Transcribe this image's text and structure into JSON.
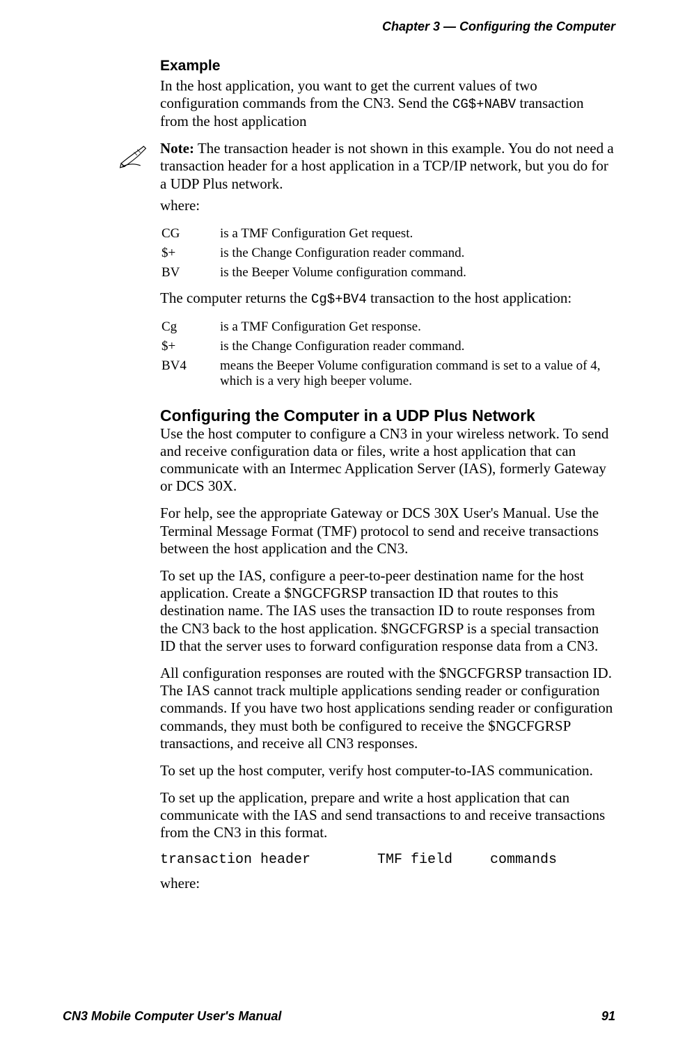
{
  "header": {
    "chapter_label": "Chapter 3 —  Configuring the Computer"
  },
  "example": {
    "heading": "Example",
    "intro_before_code": "In the host application, you want to get the current values of two configuration commands from the CN3. Send the ",
    "intro_code": "CG$+NABV",
    "intro_after_code": " transaction from the host application",
    "note_label": "Note:",
    "note_text": " The transaction header is not shown in this example. You do not need a transaction header for a host application in a TCP/IP network, but you do for a UDP Plus network.",
    "where_label": "where:",
    "table1": [
      {
        "term": "CG",
        "desc": "is a TMF Configuration Get request."
      },
      {
        "term": "$+",
        "desc": "is the Change Configuration reader command."
      },
      {
        "term": "BV",
        "desc": "is the Beeper Volume configuration command."
      }
    ],
    "returns_before_code": "The computer returns the ",
    "returns_code": "Cg$+BV4",
    "returns_after_code": " transaction to the host application:",
    "table2": [
      {
        "term": "Cg",
        "desc": "is a TMF Configuration Get response."
      },
      {
        "term": "$+",
        "desc": "is the Change Configuration reader command."
      },
      {
        "term": "BV4",
        "desc": "means the Beeper Volume configuration command is set to a value of 4, which is a very high beeper volume."
      }
    ]
  },
  "udp_section": {
    "heading": "Configuring the Computer in a UDP Plus Network",
    "p1": "Use the host computer to configure a CN3 in your wireless network. To send and receive configuration data or files, write a host application that can communicate with an Intermec Application Server (IAS), formerly Gateway or DCS 30X.",
    "p2": "For help, see the appropriate Gateway or DCS 30X User's Manual. Use the Terminal Message Format (TMF) protocol to send and receive transactions between the host application and the CN3.",
    "p3": "To set up the IAS, configure a peer-to-peer destination name for the host application. Create a $NGCFGRSP transaction ID that routes to this destination name. The IAS uses the transaction ID to route responses from the CN3 back to the host application. $NGCFGRSP is a special transaction ID that the server uses to forward configuration response data from a CN3.",
    "p4": "All configuration responses are routed with the $NGCFGRSP transaction ID. The IAS cannot track multiple applications sending reader or configuration commands. If you have two host applications sending reader or configuration commands, they must both be configured to receive the $NGCFGRSP transactions, and receive all CN3 responses.",
    "p5": "To set up the host computer, verify host computer-to-IAS communication.",
    "p6": "To set up the application, prepare and write a host application that can communicate with the IAS and send transactions to and receive transactions from the CN3 in this format.",
    "syntax_parts": {
      "a": "transaction header",
      "b": "TMF field",
      "c": "commands"
    },
    "where_label": "where:"
  },
  "footer": {
    "manual_title": "CN3 Mobile Computer User's Manual",
    "page_number": "91"
  }
}
